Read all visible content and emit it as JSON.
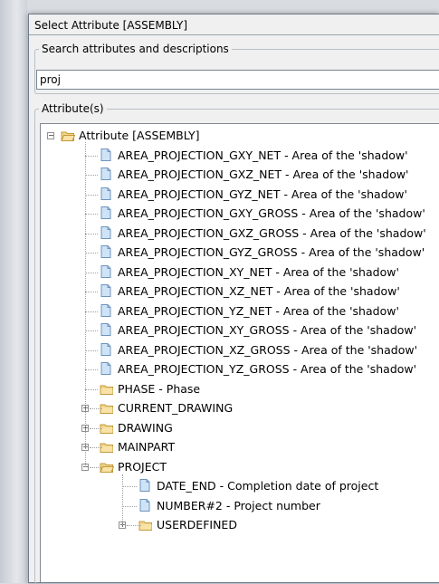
{
  "dialog": {
    "title": "Select Attribute [ASSEMBLY]",
    "search_group_label": "Search attributes and descriptions",
    "search_value": "proj",
    "attributes_group_label": "Attribute(s)"
  },
  "tree": {
    "root": {
      "label": "Attribute [ASSEMBLY]",
      "expanded": true
    },
    "items": [
      {
        "label": "AREA_PROJECTION_GXY_NET  -  Area of the 'shadow'",
        "kind": "attribute"
      },
      {
        "label": "AREA_PROJECTION_GXZ_NET  -  Area of the 'shadow'",
        "kind": "attribute"
      },
      {
        "label": "AREA_PROJECTION_GYZ_NET  -  Area of the 'shadow'",
        "kind": "attribute"
      },
      {
        "label": "AREA_PROJECTION_GXY_GROSS  -  Area of the 'shadow'",
        "kind": "attribute"
      },
      {
        "label": "AREA_PROJECTION_GXZ_GROSS  -  Area of the 'shadow'",
        "kind": "attribute"
      },
      {
        "label": "AREA_PROJECTION_GYZ_GROSS  -  Area of the 'shadow'",
        "kind": "attribute"
      },
      {
        "label": "AREA_PROJECTION_XY_NET  -  Area of the 'shadow'",
        "kind": "attribute"
      },
      {
        "label": "AREA_PROJECTION_XZ_NET  -  Area of the 'shadow'",
        "kind": "attribute"
      },
      {
        "label": "AREA_PROJECTION_YZ_NET  -  Area of the 'shadow'",
        "kind": "attribute"
      },
      {
        "label": "AREA_PROJECTION_XY_GROSS  -  Area of the 'shadow'",
        "kind": "attribute"
      },
      {
        "label": "AREA_PROJECTION_XZ_GROSS  -  Area of the 'shadow'",
        "kind": "attribute"
      },
      {
        "label": "AREA_PROJECTION_YZ_GROSS  -  Area of the 'shadow'",
        "kind": "attribute"
      },
      {
        "label": "PHASE  -  Phase",
        "kind": "folder-leaf"
      },
      {
        "label": "CURRENT_DRAWING",
        "kind": "folder-collapsed"
      },
      {
        "label": "DRAWING",
        "kind": "folder-collapsed"
      },
      {
        "label": "MAINPART",
        "kind": "folder-collapsed"
      },
      {
        "label": "PROJECT",
        "kind": "folder-expanded"
      }
    ],
    "project_children": [
      {
        "label": "DATE_END  -  Completion date of project",
        "kind": "attribute"
      },
      {
        "label": "NUMBER#2  -  Project number",
        "kind": "attribute"
      },
      {
        "label": "USERDEFINED",
        "kind": "folder-collapsed"
      }
    ]
  },
  "colors": {
    "folder_fill": "#f2d48a",
    "folder_stroke": "#c29a3a",
    "doc_fill": "#cfe3f7",
    "doc_stroke": "#6d93bd"
  }
}
